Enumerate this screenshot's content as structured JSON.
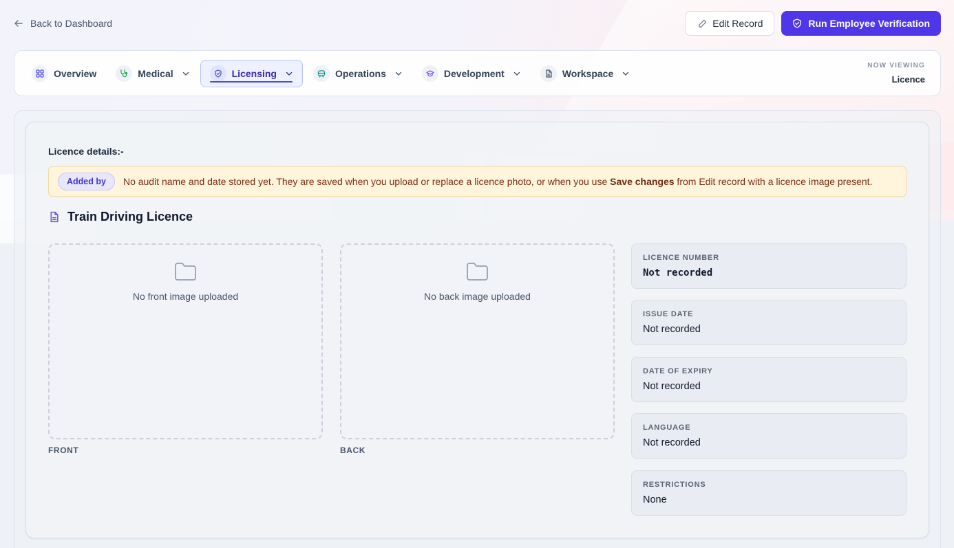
{
  "header": {
    "back_label": "Back to Dashboard",
    "edit_label": "Edit Record",
    "verify_label": "Run Employee Verification"
  },
  "nav": {
    "items": [
      {
        "label": "Overview",
        "icon": "grid-icon",
        "dropdown": false
      },
      {
        "label": "Medical",
        "icon": "stethoscope-icon",
        "dropdown": true
      },
      {
        "label": "Licensing",
        "icon": "shield-icon",
        "dropdown": true,
        "active": true
      },
      {
        "label": "Operations",
        "icon": "train-icon",
        "dropdown": true
      },
      {
        "label": "Development",
        "icon": "graduation-cap-icon",
        "dropdown": true
      },
      {
        "label": "Workspace",
        "icon": "document-icon",
        "dropdown": true
      }
    ],
    "now_viewing_label": "NOW VIEWING",
    "now_viewing_value": "Licence"
  },
  "licence": {
    "section_title": "Licence details:-",
    "notice_badge": "Added by",
    "notice_text_before": "No audit name and date stored yet. They are saved when you upload or replace a licence photo, or when you use ",
    "notice_text_bold": "Save changes",
    "notice_text_after": " from Edit record with a licence image present.",
    "title": "Train Driving Licence",
    "front_placeholder": "No front image uploaded",
    "back_placeholder": "No back image uploaded",
    "front_label": "FRONT",
    "back_label": "BACK",
    "fields": [
      {
        "label": "LICENCE NUMBER",
        "value": "Not recorded"
      },
      {
        "label": "ISSUE DATE",
        "value": "Not recorded"
      },
      {
        "label": "DATE OF EXPIRY",
        "value": "Not recorded"
      },
      {
        "label": "LANGUAGE",
        "value": "Not recorded"
      },
      {
        "label": "RESTRICTIONS",
        "value": "None"
      }
    ]
  },
  "colors": {
    "primary": "#4f36e8",
    "notice_bg": "#fff4dc",
    "active_tab": "#4f46e5"
  }
}
